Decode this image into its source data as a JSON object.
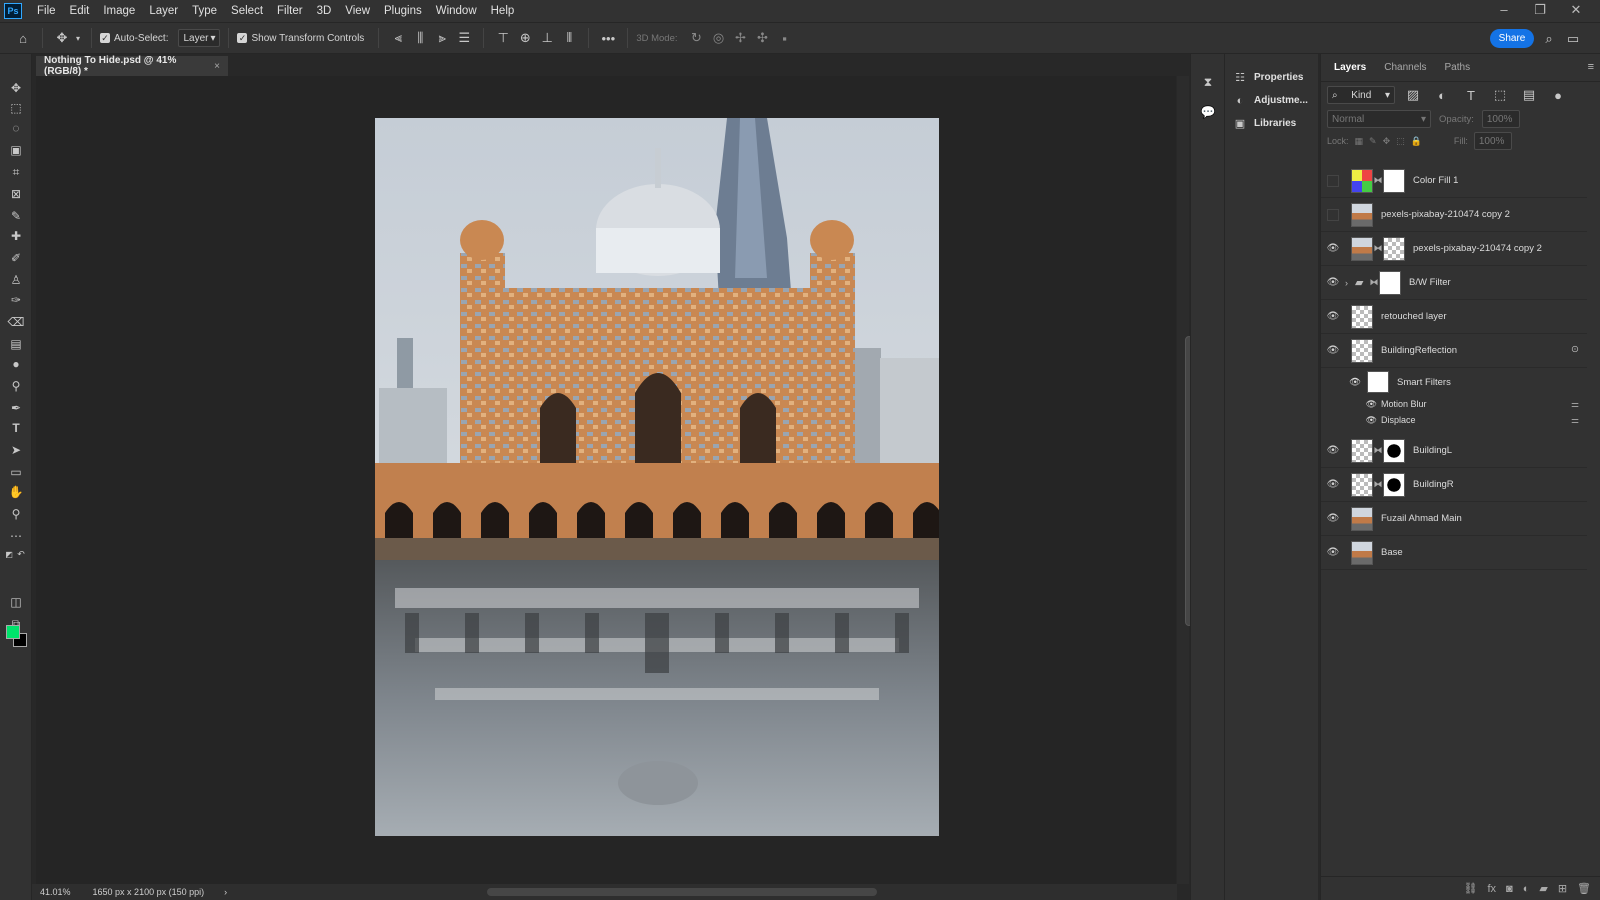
{
  "app": {
    "logo": "Ps",
    "menus": [
      "File",
      "Edit",
      "Image",
      "Layer",
      "Type",
      "Select",
      "Filter",
      "3D",
      "View",
      "Plugins",
      "Window",
      "Help"
    ],
    "window_controls": {
      "minimize": "–",
      "restore": "❐",
      "close": "✕"
    }
  },
  "options": {
    "auto_select_label": "Auto-Select:",
    "auto_select_checked": true,
    "auto_select_target": "Layer",
    "show_transform_label": "Show Transform Controls",
    "show_transform_checked": true,
    "mode_3d_label": "3D Mode:",
    "share_label": "Share",
    "more_label": "•••"
  },
  "document": {
    "tab_title": "Nothing To Hide.psd @ 41% (RGB/8) *",
    "tab_close": "×",
    "zoom": "41.01%",
    "size_info": "1650 px x 2100 px (150 ppi)",
    "status_arrow": "›"
  },
  "colors": {
    "foreground": "#00e36b",
    "background": "#000000",
    "accent": "#1473e6"
  },
  "side_panels": [
    {
      "label": "Properties",
      "icon": "sliders-icon"
    },
    {
      "label": "Adjustme...",
      "icon": "adjustments-icon"
    },
    {
      "label": "Libraries",
      "icon": "libraries-icon"
    }
  ],
  "layers_panel": {
    "tabs": [
      "Layers",
      "Channels",
      "Paths"
    ],
    "active_tab": "Layers",
    "filter_kind": "Kind",
    "blend_mode": "Normal",
    "opacity_label": "Opacity:",
    "opacity_value": "100%",
    "lock_label": "Lock:",
    "fill_label": "Fill:",
    "fill_value": "100%",
    "smart_filters_label": "Smart Filters",
    "smart_filters": [
      "Motion Blur",
      "Displace"
    ],
    "layers": [
      {
        "name": "Color Fill 1",
        "visible": false
      },
      {
        "name": "pexels-pixabay-210474 copy 2",
        "visible": false
      },
      {
        "name": "pexels-pixabay-210474 copy 2",
        "visible": true
      },
      {
        "name": "B/W Filter",
        "visible": true
      },
      {
        "name": "retouched layer",
        "visible": true
      },
      {
        "name": "BuildingReflection",
        "visible": true
      },
      {
        "name": "BuildingL",
        "visible": true
      },
      {
        "name": "BuildingR",
        "visible": true
      },
      {
        "name": "Fuzail Ahmad Main",
        "visible": true
      },
      {
        "name": "Base",
        "visible": true
      }
    ]
  }
}
